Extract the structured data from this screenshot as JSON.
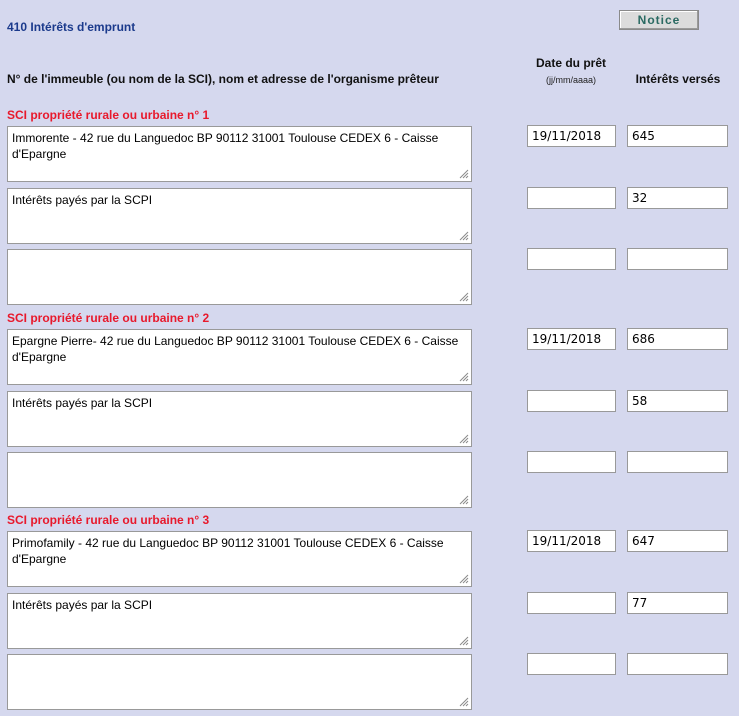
{
  "header": {
    "title": "410 Intérêts d'emprunt",
    "notice_label": "Notice"
  },
  "columns": {
    "building": "N° de l'immeuble (ou nom de la SCI), nom et adresse de l'organisme prêteur",
    "date": "Date du prêt",
    "date_format": "(jj/mm/aaaa)",
    "interest": "Intérêts versés"
  },
  "groups": [
    {
      "title": "SCI propriété rurale ou urbaine n° 1",
      "rows": [
        {
          "text": "Immorente - 42 rue du Languedoc BP 90112 31001 Toulouse CEDEX 6 - Caisse d'Epargne",
          "date": "19/11/2018",
          "interest": "645"
        },
        {
          "text": "Intérêts payés par la SCPI",
          "date": "",
          "interest": "32"
        },
        {
          "text": "",
          "date": "",
          "interest": ""
        }
      ]
    },
    {
      "title": "SCI propriété rurale ou urbaine n° 2",
      "rows": [
        {
          "text": "Epargne Pierre- 42 rue du Languedoc BP 90112 31001 Toulouse CEDEX 6 - Caisse d'Epargne",
          "date": "19/11/2018",
          "interest": "686"
        },
        {
          "text": "Intérêts payés par la SCPI",
          "date": "",
          "interest": "58"
        },
        {
          "text": "",
          "date": "",
          "interest": ""
        }
      ]
    },
    {
      "title": "SCI propriété rurale ou urbaine n° 3",
      "rows": [
        {
          "text": "Primofamily - 42 rue du Languedoc BP 90112 31001 Toulouse CEDEX 6 - Caisse d'Epargne",
          "date": "19/11/2018",
          "interest": "647"
        },
        {
          "text": "Intérêts payés par la SCPI",
          "date": "",
          "interest": "77"
        },
        {
          "text": "",
          "date": "",
          "interest": ""
        }
      ]
    }
  ],
  "colors": {
    "panel_bg": "#d5d8ee",
    "title": "#1b3a8c",
    "group_title": "#e8192c",
    "notice_text": "#2a6a62"
  }
}
